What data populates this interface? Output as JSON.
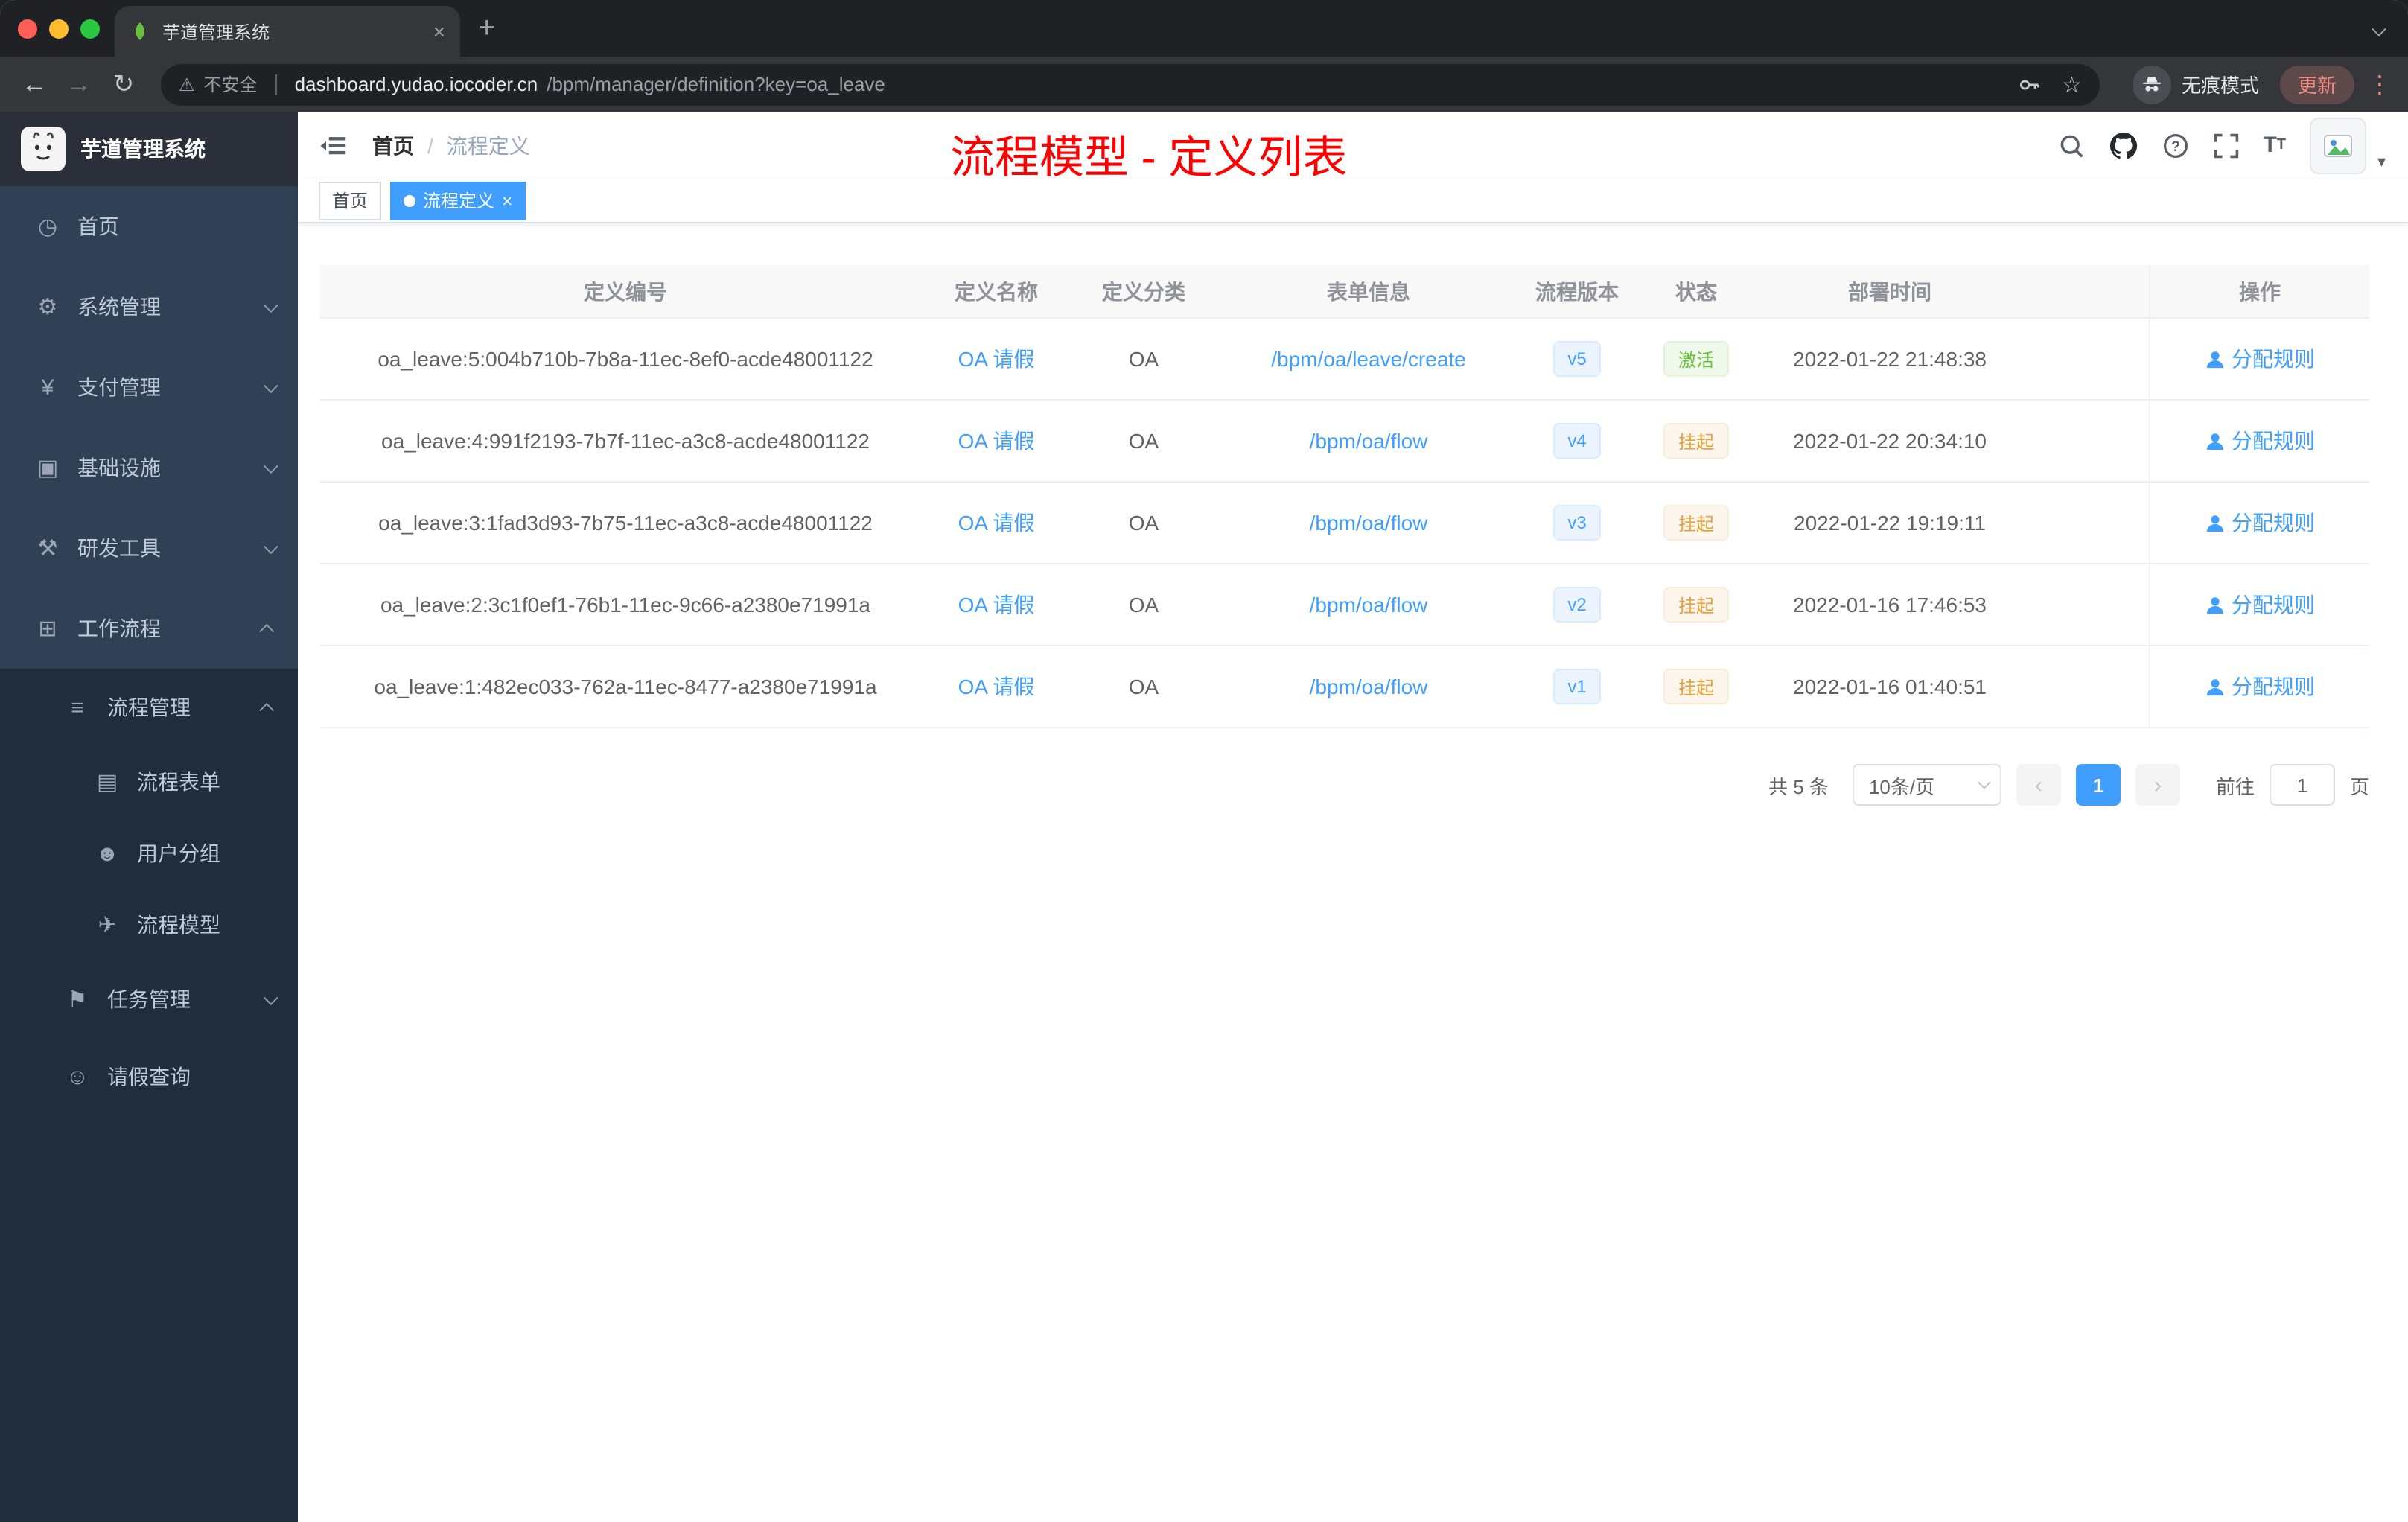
{
  "browser": {
    "tab": {
      "title": "芋道管理系统"
    },
    "icons": {
      "close": "×",
      "new_tab": "+",
      "back": "←",
      "forward": "→",
      "reload": "↻",
      "warning": "⚠",
      "star": "☆",
      "more": "⋮",
      "caret": "▾"
    },
    "omnibox": {
      "security_label": "不安全",
      "domain": "dashboard.yudao.iocoder.cn",
      "path": "/bpm/manager/definition?key=oa_leave"
    },
    "incognito_label": "无痕模式",
    "update_label": "更新"
  },
  "sidebar": {
    "logo_title": "芋道管理系统",
    "items": [
      {
        "label": "首页",
        "icon": "◷"
      },
      {
        "label": "系统管理",
        "icon": "⚙"
      },
      {
        "label": "支付管理",
        "icon": "¥"
      },
      {
        "label": "基础设施",
        "icon": "▣"
      },
      {
        "label": "研发工具",
        "icon": "⚒"
      },
      {
        "label": "工作流程",
        "icon": "⊞"
      },
      {
        "label": "流程管理",
        "icon": "≡"
      },
      {
        "label": "流程表单",
        "icon": "▤"
      },
      {
        "label": "用户分组",
        "icon": "☻"
      },
      {
        "label": "流程模型",
        "icon": "✈"
      },
      {
        "label": "任务管理",
        "icon": "⚑"
      },
      {
        "label": "请假查询",
        "icon": "☺"
      }
    ]
  },
  "navbar": {
    "breadcrumb_home": "首页",
    "breadcrumb_sep": "/",
    "breadcrumb_current": "流程定义",
    "annotation": "流程模型 - 定义列表"
  },
  "tags": {
    "home": "首页",
    "active": "流程定义",
    "close": "×"
  },
  "table": {
    "columns": {
      "id": "定义编号",
      "name": "定义名称",
      "category": "定义分类",
      "form": "表单信息",
      "version": "流程版本",
      "status": "状态",
      "deploy_time": "部署时间",
      "actions": "操作"
    },
    "action_label": "分配规则",
    "rows": [
      {
        "id": "oa_leave:5:004b710b-7b8a-11ec-8ef0-acde48001122",
        "name": "OA 请假",
        "category": "OA",
        "form": "/bpm/oa/leave/create",
        "version": "v5",
        "status": "激活",
        "status_type": "success",
        "time": "2022-01-22 21:48:38"
      },
      {
        "id": "oa_leave:4:991f2193-7b7f-11ec-a3c8-acde48001122",
        "name": "OA 请假",
        "category": "OA",
        "form": "/bpm/oa/flow",
        "version": "v4",
        "status": "挂起",
        "status_type": "warning",
        "time": "2022-01-22 20:34:10"
      },
      {
        "id": "oa_leave:3:1fad3d93-7b75-11ec-a3c8-acde48001122",
        "name": "OA 请假",
        "category": "OA",
        "form": "/bpm/oa/flow",
        "version": "v3",
        "status": "挂起",
        "status_type": "warning",
        "time": "2022-01-22 19:19:11"
      },
      {
        "id": "oa_leave:2:3c1f0ef1-76b1-11ec-9c66-a2380e71991a",
        "name": "OA 请假",
        "category": "OA",
        "form": "/bpm/oa/flow",
        "version": "v2",
        "status": "挂起",
        "status_type": "warning",
        "time": "2022-01-16 17:46:53"
      },
      {
        "id": "oa_leave:1:482ec033-762a-11ec-8477-a2380e71991a",
        "name": "OA 请假",
        "category": "OA",
        "form": "/bpm/oa/flow",
        "version": "v1",
        "status": "挂起",
        "status_type": "warning",
        "time": "2022-01-16 01:40:51"
      }
    ]
  },
  "pagination": {
    "total": "共 5 条",
    "page_size": "10条/页",
    "prev": "‹",
    "page": "1",
    "next": "›",
    "goto_label": "前往",
    "goto_value": "1",
    "unit": "页"
  }
}
